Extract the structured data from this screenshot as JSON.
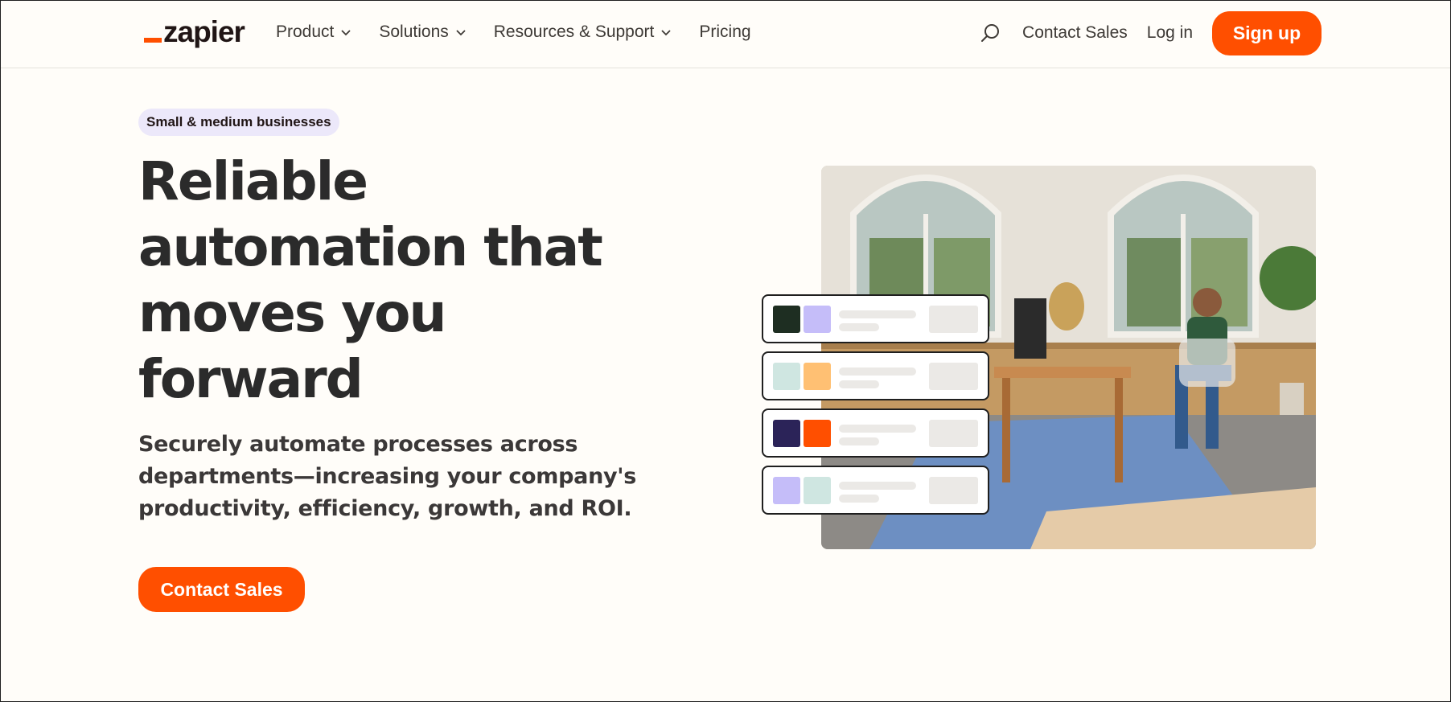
{
  "brand": {
    "name": "zapier",
    "accent": "#ff4f00"
  },
  "nav": {
    "items": [
      {
        "label": "Product",
        "dropdown": true
      },
      {
        "label": "Solutions",
        "dropdown": true
      },
      {
        "label": "Resources & Support",
        "dropdown": true
      },
      {
        "label": "Pricing",
        "dropdown": false
      }
    ],
    "contact_sales": "Contact Sales",
    "login": "Log in",
    "signup": "Sign up"
  },
  "hero": {
    "badge": "Small & medium businesses",
    "title_lines": [
      "Reliable",
      "automation that",
      "moves you",
      "forward"
    ],
    "subtitle_lines": [
      "Securely automate processes across",
      "departments—increasing your company's",
      "productivity, efficiency, growth, and ROI."
    ],
    "cta": "Contact Sales"
  },
  "workflow_cards": [
    {
      "colors": [
        "#1e2e22",
        "#c5bdf9"
      ]
    },
    {
      "colors": [
        "#cfe6e1",
        "#ffc073"
      ]
    },
    {
      "colors": [
        "#2b2358",
        "#ff4f00"
      ]
    },
    {
      "colors": [
        "#c5bdf9",
        "#cfe6e1"
      ]
    }
  ],
  "icons": {
    "search": "search-icon",
    "chevron": "chevron-down-icon"
  }
}
